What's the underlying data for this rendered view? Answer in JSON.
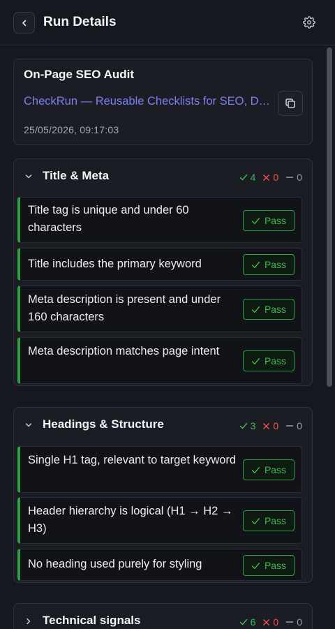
{
  "header": {
    "title": "Run Details"
  },
  "run": {
    "title": "On-Page SEO Audit",
    "link": "CheckRun — Reusable Checklists for SEO, Dev & Ops",
    "timestamp": "25/05/2026, 09:17:03"
  },
  "sections": [
    {
      "title": "Title & Meta",
      "pass": "4",
      "fail": "0",
      "skip": "0",
      "items": [
        {
          "text": "Title tag is unique and under 60 characters",
          "status": "Pass"
        },
        {
          "text": "Title includes the primary keyword",
          "status": "Pass"
        },
        {
          "text": "Meta description is present and under 160 characters",
          "status": "Pass"
        },
        {
          "text": "Meta description matches page intent",
          "status": "Pass"
        }
      ]
    },
    {
      "title": "Headings & Structure",
      "pass": "3",
      "fail": "0",
      "skip": "0",
      "items": [
        {
          "text": "Single H1 tag, relevant to target keyword",
          "status": "Pass"
        },
        {
          "text": "Header hierarchy is logical (H1 → H2 → H3)",
          "status": "Pass"
        },
        {
          "text": "No heading used purely for styling",
          "status": "Pass"
        }
      ]
    },
    {
      "title": "Technical signals",
      "pass": "6",
      "fail": "0",
      "skip": "0",
      "items": []
    }
  ],
  "colors": {
    "pass": "#3fb950",
    "fail": "#f85149",
    "link": "#7b7ff0"
  }
}
